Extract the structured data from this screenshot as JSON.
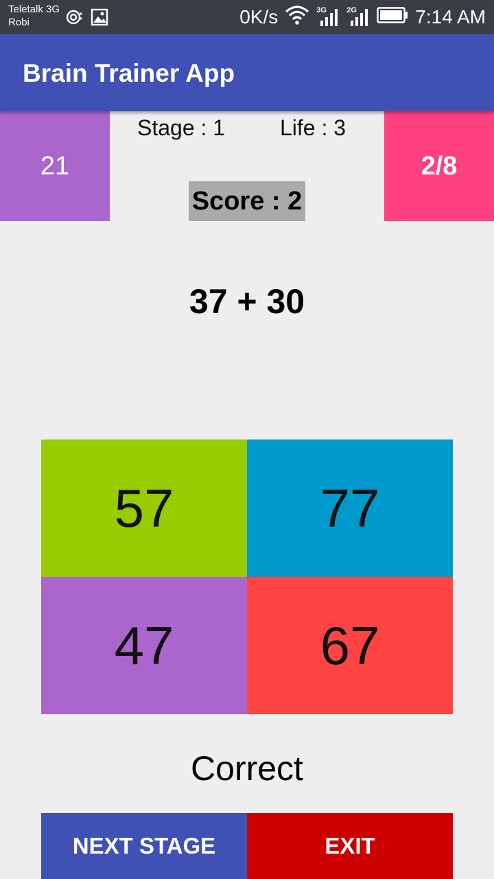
{
  "status_bar": {
    "carrier_line1": "Teletalk 3G",
    "carrier_line2": "Robi",
    "network_speed": "0K/s",
    "sim1_tag": "3G",
    "sim2_tag": "2G",
    "time": "7:14 AM",
    "icons": [
      "hotspot-icon",
      "image-icon",
      "wifi-icon",
      "signal-icon",
      "signal-icon",
      "battery-icon"
    ]
  },
  "app_bar": {
    "title": "Brain Trainer App",
    "color": "#3f51b5"
  },
  "game": {
    "timer": "21",
    "stage": "Stage : 1",
    "life": "Life : 3",
    "progress": "2/8",
    "score": "Score : 2",
    "question": "37 + 30",
    "answers": [
      {
        "value": "57",
        "color": "#99cc00"
      },
      {
        "value": "77",
        "color": "#0099cc"
      },
      {
        "value": "47",
        "color": "#aa66cc"
      },
      {
        "value": "67",
        "color": "#ff4444"
      }
    ],
    "result": "Correct"
  },
  "buttons": {
    "next_stage": "NEXT STAGE",
    "exit": "EXIT"
  }
}
